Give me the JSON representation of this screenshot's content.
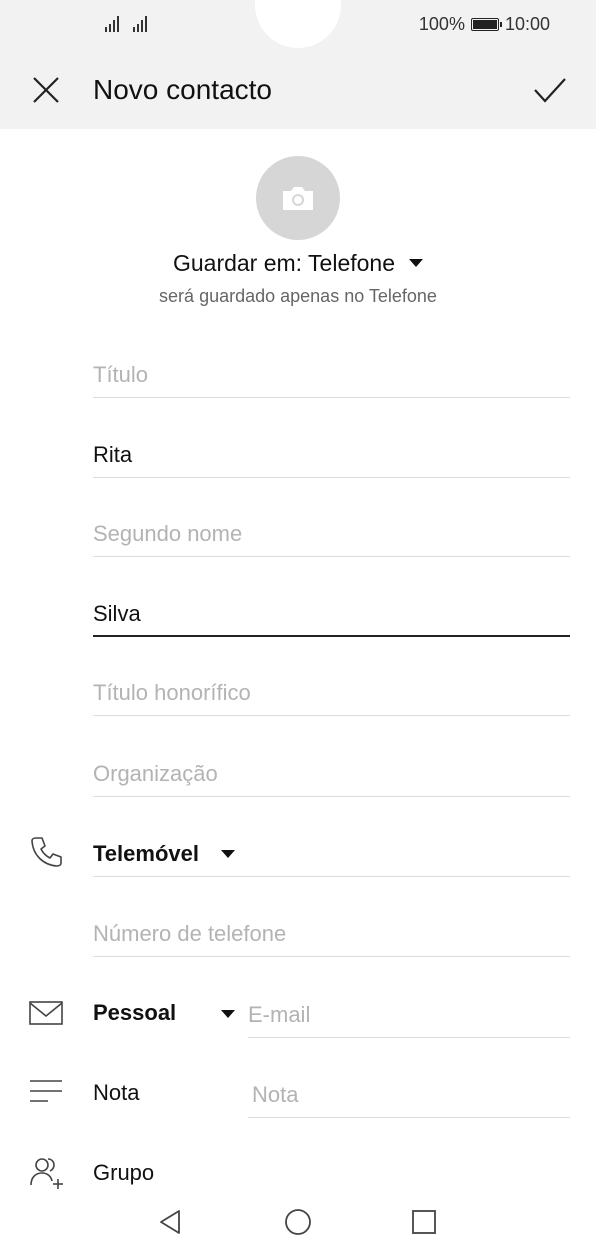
{
  "status": {
    "battery_percent": "100%",
    "time": "10:00"
  },
  "header": {
    "title": "Novo contacto"
  },
  "save_location": {
    "label": "Guardar em: Telefone",
    "subtitle": "será guardado apenas no Telefone"
  },
  "fields": {
    "title_placeholder": "Título",
    "first_name": "Rita",
    "middle_name_placeholder": "Segundo nome",
    "last_name": "Silva",
    "suffix_placeholder": "Título honorífico",
    "organization_placeholder": "Organização"
  },
  "phone": {
    "type": "Telemóvel",
    "number_placeholder": "Número de telefone"
  },
  "email": {
    "type": "Pessoal",
    "placeholder": "E-mail"
  },
  "note": {
    "label": "Nota",
    "placeholder": "Nota"
  },
  "group": {
    "label": "Grupo"
  },
  "icons": [
    "signal-icon",
    "battery-icon",
    "close-icon",
    "checkmark-icon",
    "camera-icon",
    "dropdown-arrow-icon",
    "phone-icon",
    "mail-icon",
    "note-icon",
    "group-icon",
    "back-icon",
    "home-icon",
    "recents-icon"
  ]
}
